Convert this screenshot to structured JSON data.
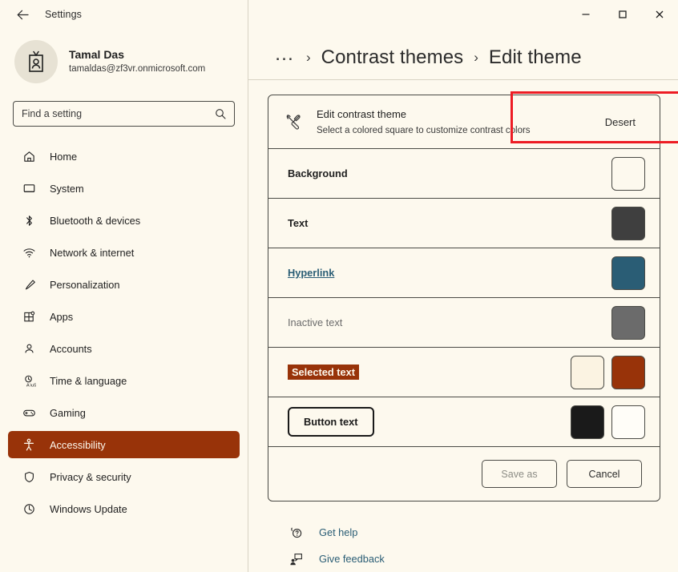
{
  "window": {
    "app_title": "Settings",
    "back_icon": "back-arrow-icon",
    "minimize_label": "–",
    "maximize_label": "□",
    "close_label": "✕"
  },
  "account": {
    "name": "Tamal Das",
    "email": "tamaldas@zf3vr.onmicrosoft.com",
    "avatar_icon": "contact-card-icon"
  },
  "search": {
    "placeholder": "Find a setting",
    "value": "",
    "icon": "search-icon"
  },
  "sidebar": {
    "items": [
      {
        "label": "Home",
        "icon": "home-icon",
        "selected": false
      },
      {
        "label": "System",
        "icon": "display-icon",
        "selected": false
      },
      {
        "label": "Bluetooth & devices",
        "icon": "bluetooth-icon",
        "selected": false
      },
      {
        "label": "Network & internet",
        "icon": "wifi-icon",
        "selected": false
      },
      {
        "label": "Personalization",
        "icon": "paintbrush-icon",
        "selected": false
      },
      {
        "label": "Apps",
        "icon": "apps-icon",
        "selected": false
      },
      {
        "label": "Accounts",
        "icon": "person-icon",
        "selected": false
      },
      {
        "label": "Time & language",
        "icon": "clock-language-icon",
        "selected": false
      },
      {
        "label": "Gaming",
        "icon": "gamepad-icon",
        "selected": false
      },
      {
        "label": "Accessibility",
        "icon": "accessibility-icon",
        "selected": true
      },
      {
        "label": "Privacy & security",
        "icon": "shield-icon",
        "selected": false
      },
      {
        "label": "Windows Update",
        "icon": "update-icon",
        "selected": false
      }
    ]
  },
  "breadcrumb": {
    "overflow": "…",
    "separator": "›",
    "parent": "Contrast themes",
    "current": "Edit theme"
  },
  "edit_theme": {
    "header": {
      "icon": "edit-theme-icon",
      "title": "Edit contrast theme",
      "subtitle": "Select a colored square to customize contrast colors",
      "value": "Desert"
    },
    "rows": [
      {
        "label": "Background",
        "style": "bold",
        "swatches": [
          {
            "name": "background-swatch",
            "color": "#fdf9ee"
          }
        ]
      },
      {
        "label": "Text",
        "style": "bold",
        "swatches": [
          {
            "name": "text-swatch",
            "color": "#3f3f3f"
          }
        ]
      },
      {
        "label": "Hyperlink",
        "style": "link",
        "swatches": [
          {
            "name": "hyperlink-swatch",
            "color": "#2a5d75"
          }
        ]
      },
      {
        "label": "Inactive text",
        "style": "muted",
        "swatches": [
          {
            "name": "inactive-text-swatch",
            "color": "#6b6b6b"
          }
        ]
      },
      {
        "label": "Selected text",
        "style": "selected",
        "swatches": [
          {
            "name": "selected-text-foreground-swatch",
            "color": "#fbf3e2"
          },
          {
            "name": "selected-text-background-swatch",
            "color": "#983309"
          }
        ]
      },
      {
        "label": "Button text",
        "style": "button",
        "swatches": [
          {
            "name": "button-text-swatch",
            "color": "#1a1a1a"
          },
          {
            "name": "button-background-swatch",
            "color": "#fffdf8"
          }
        ]
      }
    ],
    "actions": {
      "save_as": "Save as",
      "save_as_disabled": true,
      "cancel": "Cancel"
    }
  },
  "footer": {
    "links": [
      {
        "label": "Get help",
        "icon": "help-icon"
      },
      {
        "label": "Give feedback",
        "icon": "feedback-icon"
      }
    ]
  },
  "annotations": {
    "accent": "#ed1c24",
    "highlight_card": "edit-contrast-theme-header",
    "highlight_swatch": "background-swatch"
  }
}
